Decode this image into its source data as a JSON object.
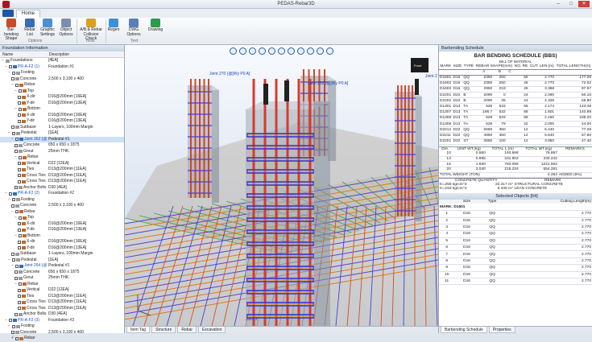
{
  "app_title": "PEDAS-Rebar3D",
  "window_controls": [
    "–",
    "□",
    "✕"
  ],
  "tabs": {
    "home": "Home"
  },
  "ribbon": {
    "buttons": [
      {
        "label": "Bar-bending Shape",
        "icon": "bar-shape-icon",
        "color": "#c74a2a"
      },
      {
        "label": "Rebar List",
        "icon": "list-icon",
        "color": "#3b6bb5"
      },
      {
        "label": "Graphic Settings",
        "icon": "graphic-settings-icon",
        "color": "#4e8fcf"
      },
      {
        "label": "Object Options",
        "icon": "object-options-icon",
        "color": "#7a8fb0"
      },
      {
        "label": "A/B & Rebar Collision Check",
        "icon": "collision-check-icon",
        "color": "#d9a021"
      },
      {
        "label": "Regen",
        "icon": "regen-icon",
        "color": "#3f8fd6"
      },
      {
        "label": "DWG Options",
        "icon": "dwg-options-icon",
        "color": "#5b7db8"
      },
      {
        "label": "Drawing",
        "icon": "drawing-icon",
        "color": "#2e9a4b"
      }
    ],
    "groups": [
      "Options",
      "Tools",
      "Text"
    ]
  },
  "left_panel": {
    "title": "Foundation Information",
    "columns": [
      "Name",
      "Description"
    ],
    "rows": [
      {
        "indent": 0,
        "tog": "−",
        "icon": "g",
        "name": "Foundations",
        "desc": "[4EA]"
      },
      {
        "indent": 1,
        "tog": "−",
        "ck": true,
        "icon": "b",
        "name": "PR-A-F2 (1)",
        "desc": "Foundation #1",
        "hi": true
      },
      {
        "indent": 2,
        "tog": "−",
        "ck": true,
        "icon": "g",
        "name": "Footing",
        "desc": ""
      },
      {
        "indent": 3,
        "ck": true,
        "icon": "g",
        "name": "Concrete",
        "desc": "2,500 x 3,100 x 400"
      },
      {
        "indent": 3,
        "tog": "−",
        "ck": true,
        "icon": "r",
        "name": "Rebar",
        "desc": ""
      },
      {
        "indent": 4,
        "tog": "−",
        "ck": true,
        "icon": "r",
        "name": "Top",
        "desc": ""
      },
      {
        "indent": 5,
        "ck": true,
        "icon": "r",
        "name": "X-dir",
        "desc": "D16@200mm [16EA]"
      },
      {
        "indent": 5,
        "ck": true,
        "icon": "r",
        "name": "Y-dir",
        "desc": "D16@200mm [13EA]"
      },
      {
        "indent": 4,
        "tog": "−",
        "ck": true,
        "icon": "r",
        "name": "Bottom",
        "desc": ""
      },
      {
        "indent": 5,
        "ck": true,
        "icon": "r",
        "name": "X-dir",
        "desc": "D16@200mm [16EA]"
      },
      {
        "indent": 5,
        "ck": true,
        "icon": "r",
        "name": "Y-dir",
        "desc": "D16@200mm [13EA]"
      },
      {
        "indent": 3,
        "ck": true,
        "icon": "g",
        "name": "Subbase",
        "desc": "1-Layers, 100mm Margin"
      },
      {
        "indent": 2,
        "tog": "−",
        "ck": true,
        "icon": "g",
        "name": "Pedestal",
        "desc": "[1EA]"
      },
      {
        "indent": 3,
        "tog": "−",
        "ck": true,
        "icon": "b",
        "name": "Joint 262 (@[Gt...",
        "desc": "Pedestal #1",
        "hi": true,
        "hl": true
      },
      {
        "indent": 4,
        "ck": true,
        "icon": "g",
        "name": "Concrete",
        "desc": "650 x 650 x 1875"
      },
      {
        "indent": 4,
        "ck": true,
        "icon": "g",
        "name": "Grout",
        "desc": "25mm THK."
      },
      {
        "indent": 4,
        "tog": "−",
        "ck": true,
        "icon": "r",
        "name": "Rebar",
        "desc": ""
      },
      {
        "indent": 5,
        "ck": true,
        "icon": "r",
        "name": "Vertical",
        "desc": "D22 [12EA]"
      },
      {
        "indent": 5,
        "ck": true,
        "icon": "r",
        "name": "Ties",
        "desc": "D13@200mm [11EA]"
      },
      {
        "indent": 5,
        "ck": true,
        "icon": "r",
        "name": "Cross Ties 01",
        "desc": "D13@200mm [11EA]"
      },
      {
        "indent": 5,
        "ck": true,
        "icon": "r",
        "name": "Cross Ties 02",
        "desc": "D13@200mm [11EA]"
      },
      {
        "indent": 4,
        "ck": true,
        "icon": "g",
        "name": "Anchor Bolts",
        "desc": "D30 [4EA]"
      },
      {
        "indent": 1,
        "tog": "−",
        "ck": true,
        "icon": "b",
        "name": "PR-A-F2 (2)",
        "desc": "Foundation #2",
        "hi": true
      },
      {
        "indent": 2,
        "tog": "−",
        "ck": true,
        "icon": "g",
        "name": "Footing",
        "desc": ""
      },
      {
        "indent": 3,
        "ck": true,
        "icon": "g",
        "name": "Concrete",
        "desc": "2,500 x 3,100 x 400"
      },
      {
        "indent": 3,
        "tog": "−",
        "ck": true,
        "icon": "r",
        "name": "Rebar",
        "desc": ""
      },
      {
        "indent": 4,
        "tog": "−",
        "ck": true,
        "icon": "r",
        "name": "Top",
        "desc": ""
      },
      {
        "indent": 5,
        "ck": true,
        "icon": "r",
        "name": "X-dir",
        "desc": "D16@200mm [16EA]"
      },
      {
        "indent": 5,
        "ck": true,
        "icon": "r",
        "name": "Y-dir",
        "desc": "D16@200mm [13EA]"
      },
      {
        "indent": 4,
        "tog": "−",
        "ck": true,
        "icon": "r",
        "name": "Bottom",
        "desc": ""
      },
      {
        "indent": 5,
        "ck": true,
        "icon": "r",
        "name": "X-dir",
        "desc": "D16@200mm [16EA]"
      },
      {
        "indent": 5,
        "ck": true,
        "icon": "r",
        "name": "Y-dir",
        "desc": "D16@200mm [13EA]"
      },
      {
        "indent": 3,
        "ck": true,
        "icon": "g",
        "name": "Subbase",
        "desc": "1-Layers, 100mm Margin"
      },
      {
        "indent": 2,
        "tog": "−",
        "ck": true,
        "icon": "g",
        "name": "Pedestal",
        "desc": "[1EA]"
      },
      {
        "indent": 3,
        "tog": "−",
        "ck": true,
        "icon": "b",
        "name": "Joint 264 (@[Gt...",
        "desc": "Pedestal #1",
        "hi": true
      },
      {
        "indent": 4,
        "ck": true,
        "icon": "g",
        "name": "Concrete",
        "desc": "650 x 650 x 1875"
      },
      {
        "indent": 4,
        "ck": true,
        "icon": "g",
        "name": "Grout",
        "desc": "25mm THK."
      },
      {
        "indent": 4,
        "tog": "−",
        "ck": true,
        "icon": "r",
        "name": "Rebar",
        "desc": ""
      },
      {
        "indent": 5,
        "ck": true,
        "icon": "r",
        "name": "Vertical",
        "desc": "D22 [12EA]"
      },
      {
        "indent": 5,
        "ck": true,
        "icon": "r",
        "name": "Ties",
        "desc": "D13@200mm [11EA]"
      },
      {
        "indent": 5,
        "ck": true,
        "icon": "r",
        "name": "Cross Ties 01",
        "desc": "D13@200mm [11EA]"
      },
      {
        "indent": 5,
        "ck": true,
        "icon": "r",
        "name": "Cross Ties 02",
        "desc": "D13@200mm [11EA]"
      },
      {
        "indent": 4,
        "ck": true,
        "icon": "g",
        "name": "Anchor Bolts",
        "desc": "D30 [4EA]"
      },
      {
        "indent": 1,
        "tog": "−",
        "ck": true,
        "icon": "b",
        "name": "PR-A-F2 (3)",
        "desc": "Foundation #3",
        "hi": true
      },
      {
        "indent": 2,
        "tog": "−",
        "ck": true,
        "icon": "g",
        "name": "Footing",
        "desc": ""
      },
      {
        "indent": 3,
        "ck": true,
        "icon": "g",
        "name": "Concrete",
        "desc": "2,500 x 3,100 x 400"
      },
      {
        "indent": 3,
        "tog": "+",
        "ck": true,
        "icon": "r",
        "name": "Rebar",
        "desc": ""
      }
    ]
  },
  "viewport": {
    "labels": [
      "Joint 270 (@[Wy P0 A]",
      "Joint 262 (@[Wy P0 A]",
      "Joint 2",
      "Joint 2"
    ],
    "tabs": [
      "Item Tag",
      "Structure",
      "Rebar",
      "Excavation"
    ],
    "view_cube": "Front"
  },
  "right_panel": {
    "title": "Barbending Schedule",
    "bbs_title": "BAR BENDING SCHEDULE (BBS)",
    "bom_title": "BILL OF MATERIAL",
    "headers": [
      "MARK",
      "SIZE",
      "TYPE",
      "REBAR SHAPE(mm)",
      "",
      "",
      "NO. RE",
      "CUT. LEN.(m)",
      "TOTAL LENGTH(m)"
    ],
    "subheaders": [
      "A",
      "B",
      "C"
    ],
    "rows": [
      [
        "D1601",
        "D16",
        "QQ",
        "2350",
        "250",
        "",
        "56",
        "2.770",
        "177.26"
      ],
      [
        "D1602",
        "D16",
        "QQ",
        "2350",
        "250",
        "",
        "26",
        "2.770",
        "72.02"
      ],
      [
        "D1603",
        "D16",
        "QQ",
        "2950",
        "218",
        "",
        "26",
        "3.368",
        "87.57"
      ],
      [
        "D2201",
        "D22",
        "B",
        "2090",
        "0",
        "",
        "24",
        "2.090",
        "50.16"
      ],
      [
        "D2202",
        "D22",
        "B",
        "2090",
        "35",
        "",
        "24",
        "2.325",
        "55.80"
      ],
      [
        "D1301",
        "D13",
        "TA",
        "536",
        "533",
        "",
        "66",
        "2.174",
        "143.48"
      ],
      [
        "D1307",
        "D13",
        "TA",
        "196.7",
        "532",
        "",
        "88",
        "1.601",
        "140.89"
      ],
      [
        "D1308",
        "D13",
        "TA",
        "529",
        "533",
        "",
        "88",
        "2.150",
        "189.20"
      ],
      [
        "D1309",
        "D13",
        "TA",
        "529",
        "79",
        "",
        "22",
        "2.000",
        "44.00"
      ],
      [
        "D2212",
        "D22",
        "QQ",
        "5650",
        "350",
        "",
        "12",
        "6.440",
        "77.28"
      ],
      [
        "D2211",
        "D22",
        "QQ",
        "4850",
        "350",
        "",
        "12",
        "5.640",
        "67.68"
      ],
      [
        "D2201",
        "D22",
        "ST",
        "3550",
        "100",
        "",
        "12",
        "3.950",
        "47.40"
      ]
    ],
    "summary_headers": [
      "DIA.",
      "UNIT WT.(kg)",
      "TOTAL L.(m)",
      "TOTAL WT.(kg)",
      "REMARKS"
    ],
    "summary_rows": [
      [
        "10",
        "0.560",
        "140.888",
        "78.897",
        ""
      ],
      [
        "13",
        "0.995",
        "331.902",
        "330.242",
        ""
      ],
      [
        "16",
        "1.560",
        "783.096",
        "1221.562",
        ""
      ],
      [
        "20",
        "3.040",
        "215.224",
        "654.281",
        ""
      ]
    ],
    "total_row": [
      "TOTAL WEIGHT (TON)",
      "2.284",
      "ADDED (5%)"
    ],
    "concrete_headers": [
      "CONCRETE QUANTITY",
      "REMARK"
    ],
    "concrete_rows": [
      [
        "fc=255 kg/cm^2",
        "22.317 m³",
        "STRUCTURAL CONCRETE"
      ],
      [
        "fc=153 kg/cm^2",
        "0.446 m³",
        "LEAN CONCRETE"
      ]
    ],
    "selected_title": "Selected Objects [64]",
    "sel_headers": [
      "",
      "Size",
      "Type",
      "Cutting Length(m)"
    ],
    "group_label": "MARK: D1601",
    "sel_rows": [
      [
        "1",
        "D16",
        "QQ",
        "2.770"
      ],
      [
        "2",
        "D16",
        "QQ",
        "2.770"
      ],
      [
        "3",
        "D16",
        "QQ",
        "2.770"
      ],
      [
        "4",
        "D16",
        "QQ",
        "2.770"
      ],
      [
        "5",
        "D16",
        "QQ",
        "2.770"
      ],
      [
        "6",
        "D16",
        "QQ",
        "2.770"
      ],
      [
        "7",
        "D16",
        "QQ",
        "2.770"
      ],
      [
        "8",
        "D16",
        "QQ",
        "2.770"
      ],
      [
        "9",
        "D16",
        "QQ",
        "2.770"
      ],
      [
        "10",
        "D16",
        "QQ",
        "2.770"
      ],
      [
        "11",
        "D16",
        "QQ",
        "2.770"
      ]
    ],
    "tabs": [
      "Barbending Schedule",
      "Properties"
    ]
  }
}
